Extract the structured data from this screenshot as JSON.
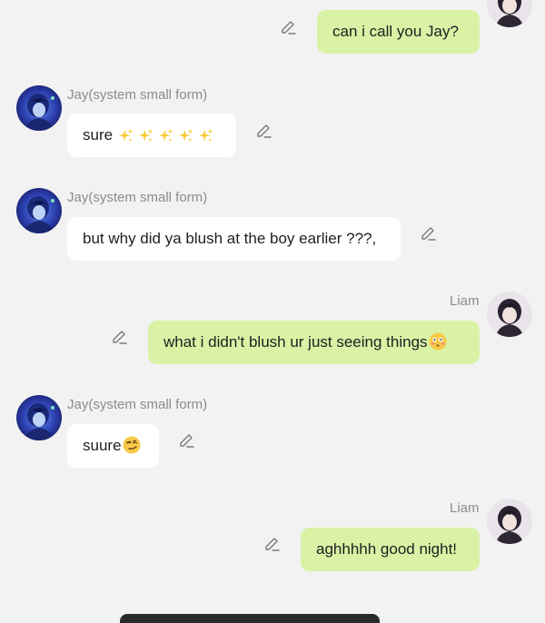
{
  "colors": {
    "background": "#f2f2f2",
    "incoming_bubble": "#ffffff",
    "outgoing_bubble": "#d9f2a5",
    "name_text": "#8c8c8c"
  },
  "messages": [
    {
      "sender": "",
      "text": "can i call you Jay?",
      "direction": "outgoing"
    },
    {
      "sender": "Jay(system small form)",
      "text": "sure",
      "emoji": "sparkles-x5",
      "direction": "incoming"
    },
    {
      "sender": "Jay(system small form)",
      "text": "but why did ya blush at the boy earlier ???,",
      "direction": "incoming"
    },
    {
      "sender": "Liam",
      "text": "what i didn't blush ur just seeing things",
      "emoji": "flushed-face",
      "direction": "outgoing"
    },
    {
      "sender": "Jay(system small form)",
      "text": "suure",
      "emoji": "smirking-face",
      "direction": "incoming"
    },
    {
      "sender": "Liam",
      "text": "aghhhhh good night!",
      "direction": "outgoing"
    }
  ]
}
